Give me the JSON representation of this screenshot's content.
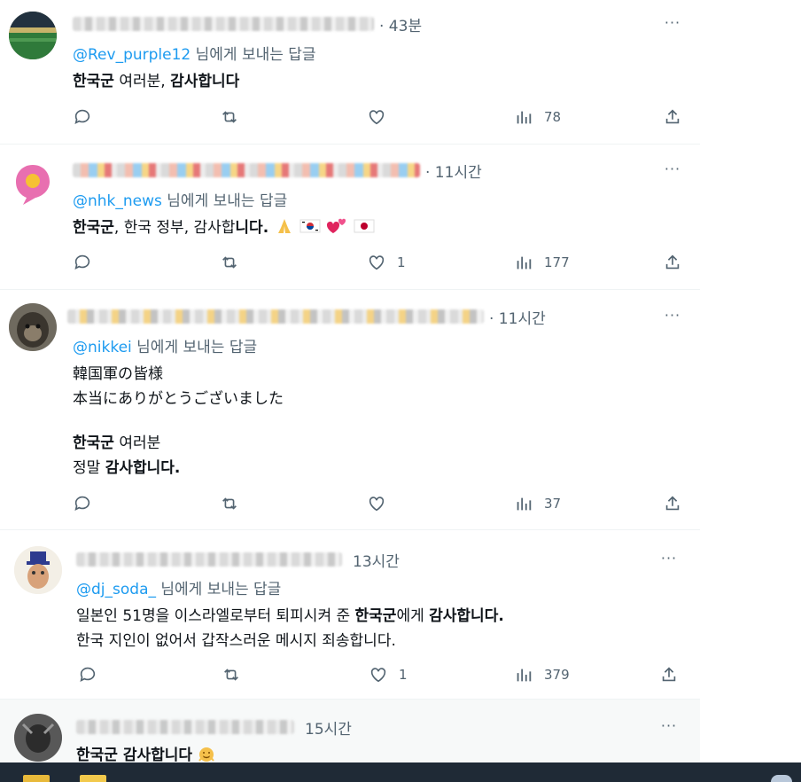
{
  "reply_prefix_suffix": " 님에게 보내는 답글",
  "more_glyph": "···",
  "tweets": [
    {
      "time": "· 43분",
      "reply_handle": "@Rev_purple12",
      "lines": [
        [
          {
            "t": "한국군",
            "b": true
          },
          {
            "t": " 여러분, ",
            "b": false
          },
          {
            "t": "감사합니다",
            "b": true
          }
        ]
      ],
      "likes": "",
      "views": "78"
    },
    {
      "time": "· 11시간",
      "reply_handle": "@nhk_news",
      "lines": [
        [
          {
            "t": "한국군",
            "b": true
          },
          {
            "t": ", 한국 정부, 감사합",
            "b": false
          },
          {
            "t": "니다.",
            "b": true
          }
        ]
      ],
      "emoji_after": [
        "folded-hands",
        "korea-flag",
        "hearts",
        "japan-flag"
      ],
      "likes": "1",
      "views": "177"
    },
    {
      "time": "· 11시간",
      "reply_handle": "@nikkei",
      "lines": [
        [
          {
            "t": "韓国軍の皆様",
            "b": false
          }
        ],
        [
          {
            "t": "本当にありがとうございました",
            "b": false
          }
        ],
        [
          {
            "t": "",
            "b": false
          }
        ],
        [
          {
            "t": "한국군",
            "b": true
          },
          {
            "t": " 여러분",
            "b": false
          }
        ],
        [
          {
            "t": "정말 ",
            "b": false
          },
          {
            "t": "감사합니다.",
            "b": true
          }
        ]
      ],
      "likes": "",
      "views": "37"
    },
    {
      "time": "13시간",
      "reply_handle": "@dj_soda_",
      "lines": [
        [
          {
            "t": "일본인 51명을 이스라엘로부터 퇴피시켜 준 ",
            "b": false
          },
          {
            "t": "한국군",
            "b": true
          },
          {
            "t": "에게 ",
            "b": false
          },
          {
            "t": "감사합니다.",
            "b": true
          }
        ],
        [
          {
            "t": "한국 지인이 없어서 갑작스러운 메시지 죄송합니다.",
            "b": false
          }
        ]
      ],
      "likes": "1",
      "views": "379"
    },
    {
      "time": "15시간",
      "reply_handle": "",
      "lines": [
        [
          {
            "t": "한국군 감사합니다",
            "b": true
          }
        ]
      ],
      "emoji_after": [
        "grateful-face"
      ],
      "likes": "",
      "views": ""
    }
  ]
}
